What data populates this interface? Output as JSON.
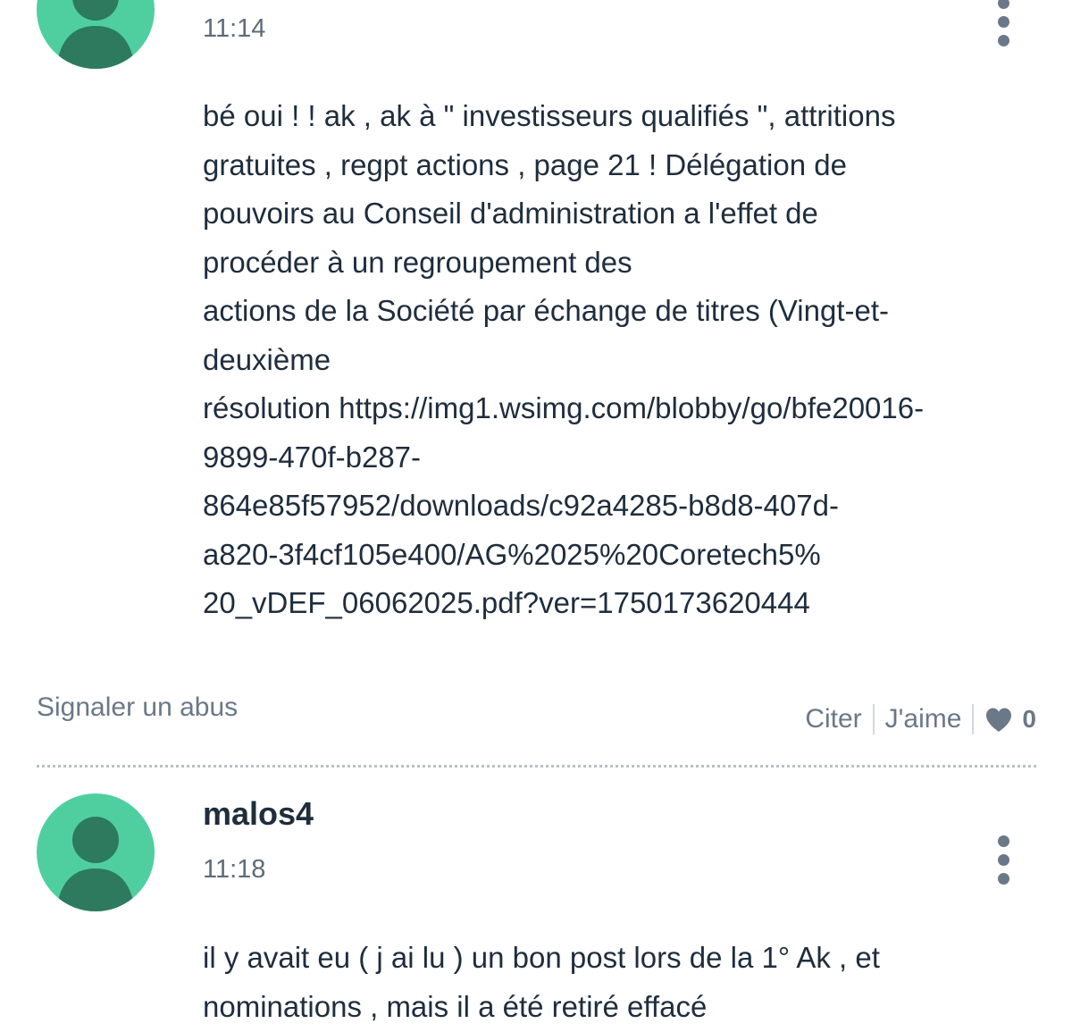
{
  "post1": {
    "time": "11:14",
    "lines": [
      "bé oui ! ! ak , ak à \" investisseurs qualifiés \", attritions",
      "gratuites , regpt actions , page 21 ! Délégation de",
      "pouvoirs au Conseil d'administration a l'effet de",
      "procéder à un regroupement des",
      "actions de la Société par échange de titres (Vingt-et-",
      "deuxième",
      "résolution https://img1.wsimg.com/blobby/go/bfe20016-",
      "9899-470f-b287-",
      "864e85f57952/downloads/c92a4285-b8d8-407d-",
      "a820-3f4cf105e400/AG%2025%20Coretech5%",
      "20_vDEF_06062025.pdf?ver=1750173620444"
    ],
    "report_label": "Signaler un abus",
    "quote_label": "Citer",
    "like_label": "J'aime",
    "like_count": "0"
  },
  "post2": {
    "username": "malos4",
    "time": "11:18",
    "lines": [
      "il y avait eu ( j ai lu ) un bon post lors de la 1° Ak , et",
      "nominations , mais il a été retiré effacé"
    ]
  },
  "icons": {
    "avatar": "user-silhouette-icon",
    "menu": "more-vertical-icon",
    "like": "heart-icon"
  },
  "colors": {
    "avatar_bg": "#4fcf9f",
    "avatar_figure": "#2d7a5e",
    "text": "#1f2d3d",
    "muted": "#6b7888"
  }
}
